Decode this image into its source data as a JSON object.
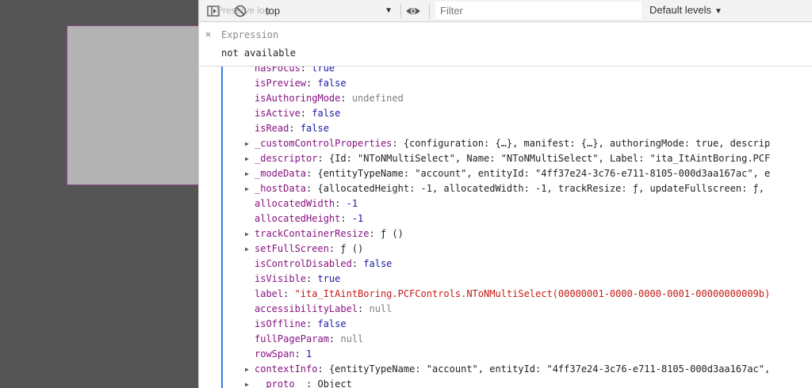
{
  "toolbar": {
    "ghost_text": "Preserve log",
    "context": "top",
    "filter_placeholder": "Filter",
    "levels": "Default levels"
  },
  "expression": {
    "label": "Expression",
    "value": "not available"
  },
  "properties": [
    {
      "key": "hasFocus",
      "value": "true",
      "type": "bool",
      "expandable": false
    },
    {
      "key": "isPreview",
      "value": "false",
      "type": "bool",
      "expandable": false
    },
    {
      "key": "isAuthoringMode",
      "value": "undefined",
      "type": "null",
      "expandable": false
    },
    {
      "key": "isActive",
      "value": "false",
      "type": "bool",
      "expandable": false
    },
    {
      "key": "isRead",
      "value": "false",
      "type": "bool",
      "expandable": false
    },
    {
      "key": "_customControlProperties",
      "value": "{configuration: {…}, manifest: {…}, authoringMode: true, descrip",
      "type": "obj",
      "expandable": true
    },
    {
      "key": "_descriptor",
      "value": "{Id: \"NToNMultiSelect\", Name: \"NToNMultiSelect\", Label: \"ita_ItAintBoring.PCF",
      "type": "obj",
      "expandable": true
    },
    {
      "key": "_modeData",
      "value": "{entityTypeName: \"account\", entityId: \"4ff37e24-3c76-e711-8105-000d3aa167ac\", e",
      "type": "obj",
      "expandable": true
    },
    {
      "key": "_hostData",
      "value": "{allocatedHeight: -1, allocatedWidth: -1, trackResize: ƒ, updateFullscreen: ƒ,",
      "type": "obj",
      "expandable": true
    },
    {
      "key": "allocatedWidth",
      "value": "-1",
      "type": "num",
      "expandable": false
    },
    {
      "key": "allocatedHeight",
      "value": "-1",
      "type": "num",
      "expandable": false
    },
    {
      "key": "trackContainerResize",
      "value": "ƒ ()",
      "type": "obj",
      "expandable": true
    },
    {
      "key": "setFullScreen",
      "value": "ƒ ()",
      "type": "obj",
      "expandable": true
    },
    {
      "key": "isControlDisabled",
      "value": "false",
      "type": "bool",
      "expandable": false
    },
    {
      "key": "isVisible",
      "value": "true",
      "type": "bool",
      "expandable": false
    },
    {
      "key": "label",
      "value": "\"ita_ItAintBoring.PCFControls.NToNMultiSelect(00000001-0000-0000-0001-00000000009b)",
      "type": "str",
      "expandable": false
    },
    {
      "key": "accessibilityLabel",
      "value": "null",
      "type": "null",
      "expandable": false
    },
    {
      "key": "isOffline",
      "value": "false",
      "type": "bool",
      "expandable": false
    },
    {
      "key": "fullPageParam",
      "value": "null",
      "type": "null",
      "expandable": false
    },
    {
      "key": "rowSpan",
      "value": "1",
      "type": "num",
      "expandable": false
    },
    {
      "key": "contextInfo",
      "value": "{entityTypeName: \"account\", entityId: \"4ff37e24-3c76-e711-8105-000d3aa167ac\",",
      "type": "obj",
      "expandable": true
    },
    {
      "key": "__proto__",
      "value": "Object",
      "type": "obj",
      "expandable": true
    }
  ]
}
